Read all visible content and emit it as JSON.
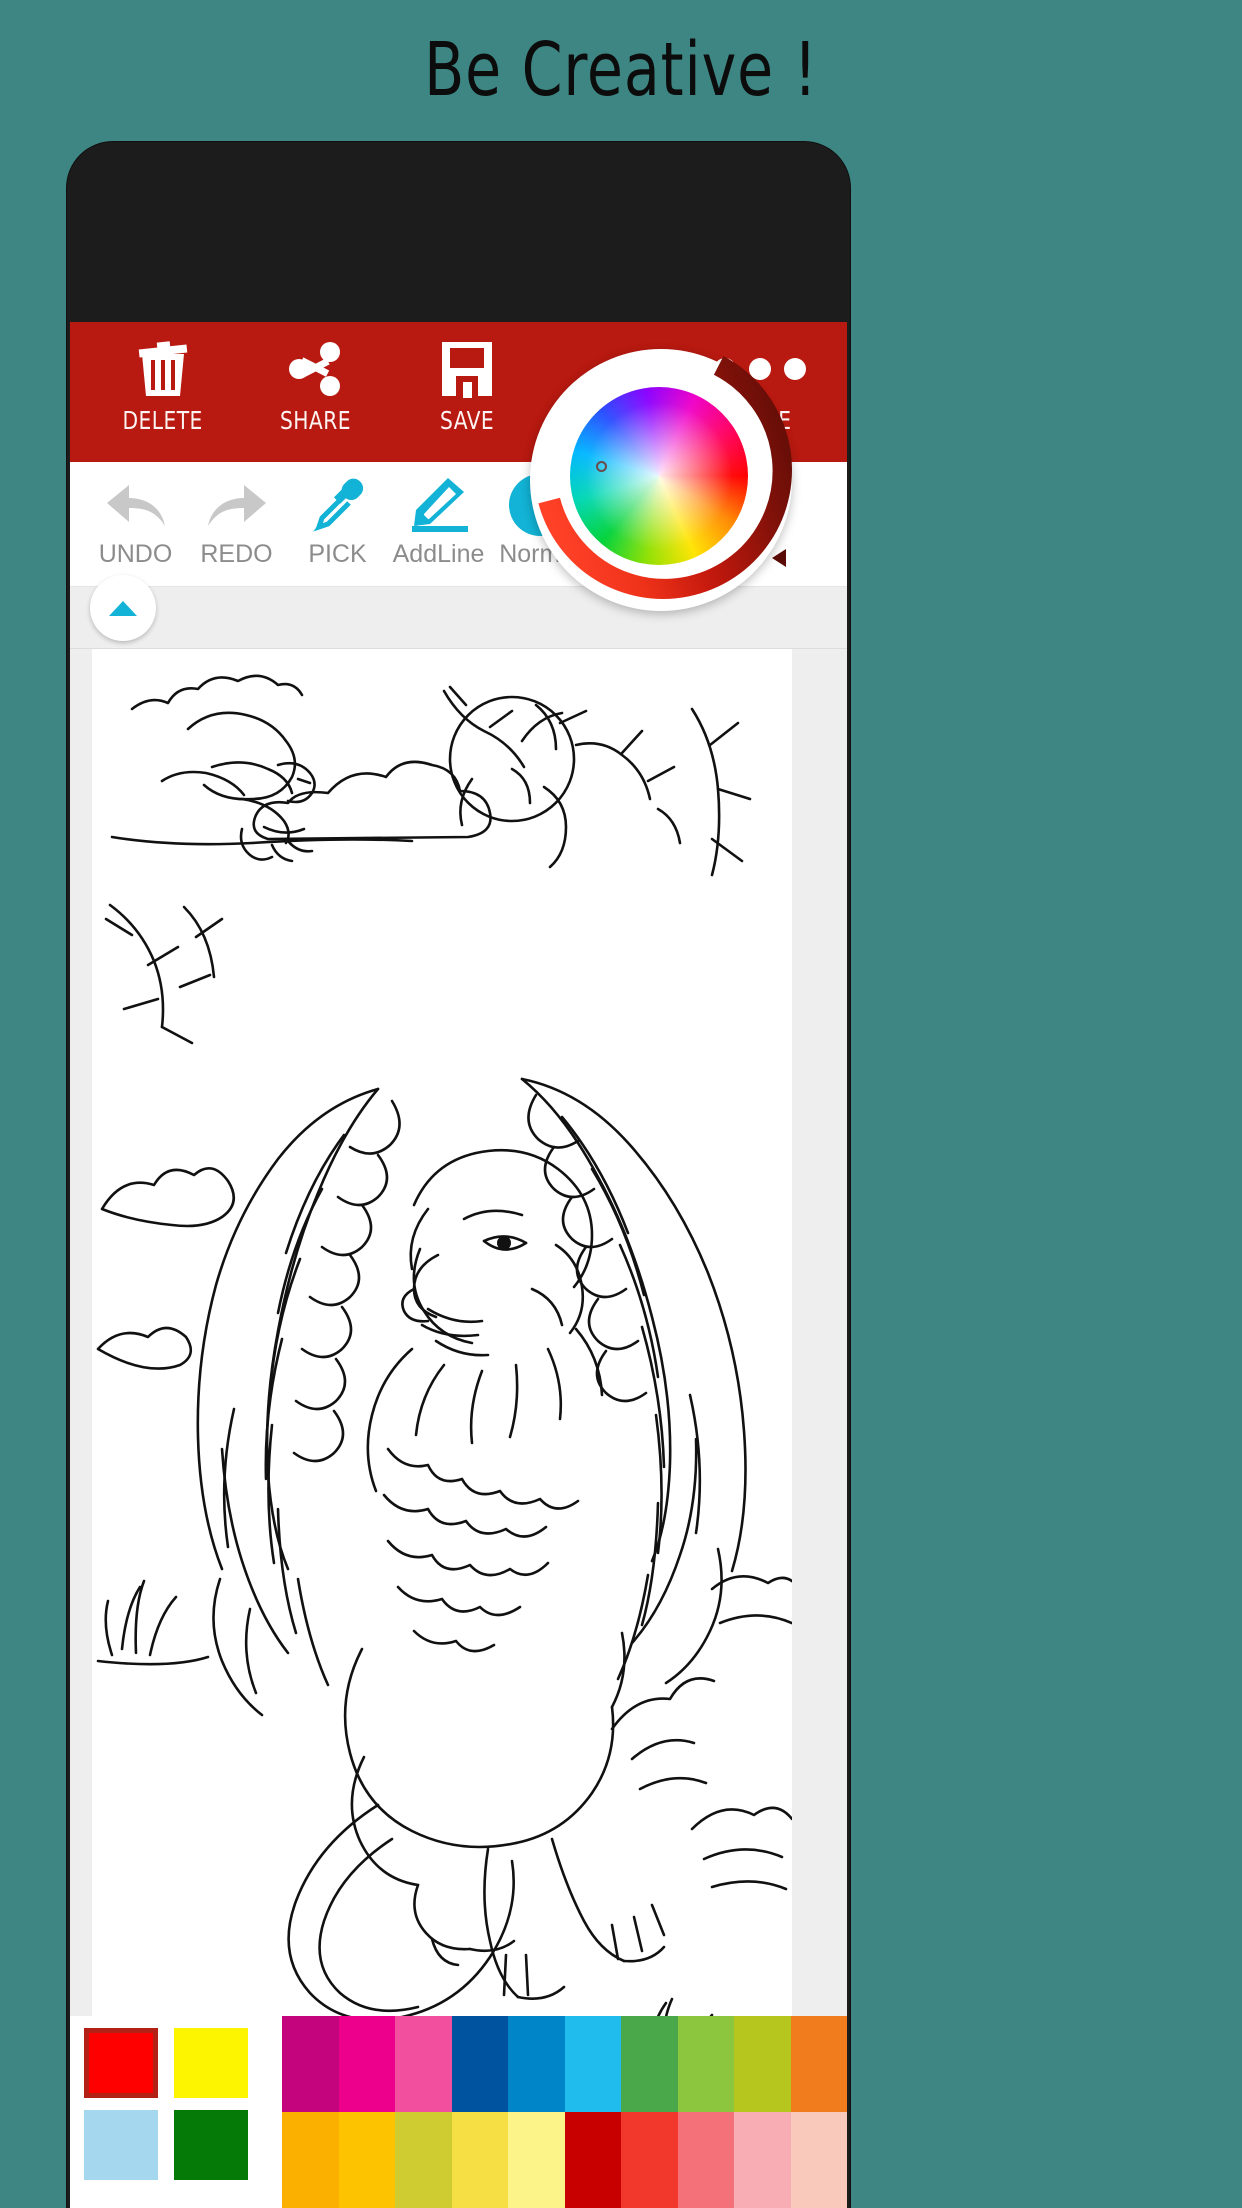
{
  "headline": {
    "text": "Be Creative !",
    "color": "#0c0c0c",
    "background": "#3d8683"
  },
  "actionbar": {
    "background": "#b81910",
    "items": [
      {
        "id": "delete",
        "label": "DELETE",
        "icon": "trash-icon"
      },
      {
        "id": "share",
        "label": "SHARE",
        "icon": "share-icon"
      },
      {
        "id": "save",
        "label": "SAVE",
        "icon": "floppy-disk-save-icon"
      },
      {
        "id": "more",
        "label": "MORE",
        "icon": "overflow-dots-icon"
      }
    ]
  },
  "tools": {
    "disabled_color": "#c8c8c8",
    "active_color": "#12b3d6",
    "label_color": "#8c8c8c",
    "items": [
      {
        "id": "undo",
        "label": "UNDO",
        "icon": "undo-arrow-icon",
        "state": "disabled"
      },
      {
        "id": "redo",
        "label": "REDO",
        "icon": "redo-arrow-icon",
        "state": "disabled"
      },
      {
        "id": "pick",
        "label": "PICK",
        "icon": "eyedropper-icon",
        "state": "enabled"
      },
      {
        "id": "addline",
        "label": "AddLine",
        "icon": "pencil-line-icon",
        "state": "enabled"
      },
      {
        "id": "normal",
        "label": "Normal",
        "icon": "filled-circle-icon",
        "state": "enabled",
        "swatch": "#12b3d6"
      }
    ]
  },
  "collapse": {
    "icon": "triangle-up-icon",
    "arrow_color": "#12b3d6"
  },
  "canvas": {
    "artwork": "griffin-coloring-line-art",
    "background": "#ffffff"
  },
  "color_wheel": {
    "icon": "color-wheel-picker",
    "ring_colors": [
      "#5a0b06",
      "#8c1208",
      "#d21a0c",
      "#ee2d14",
      "#ff3a20"
    ],
    "cursor_position": "upper-left",
    "selected_color": "#12b3d6"
  },
  "palettes": {
    "recent_selected_index": 0,
    "recent": [
      "#ff0000",
      "#fdf500",
      "#a5d8ef",
      "#067a06"
    ],
    "grid": [
      [
        "#c3047c",
        "#ec008c",
        "#f росс",
        "#00539f",
        "#0085c8",
        "#1fbced",
        "#4aa84a",
        "#8cc63e",
        "#b7c61f",
        "#f07c1e"
      ],
      [
        "#fbb000",
        "#fdc300",
        "#cfcc32",
        "#f6df45",
        "#fdf489",
        "#c90000",
        "#f2382c",
        "#f4717a",
        "#f8acb4",
        "#f9c9bb"
      ]
    ],
    "grid_row1": [
      "#c3047c",
      "#ec008c",
      "#f2509f",
      "#00539f",
      "#0085c8",
      "#1fbced",
      "#4aa84a",
      "#8cc63e",
      "#b7c61f",
      "#f07c1e"
    ],
    "grid_row2": [
      "#fbb000",
      "#fdc300",
      "#cfcc32",
      "#f6df45",
      "#fdf489",
      "#c90000",
      "#f2382c",
      "#f4717a",
      "#f8acb4",
      "#f9c9bb"
    ]
  }
}
